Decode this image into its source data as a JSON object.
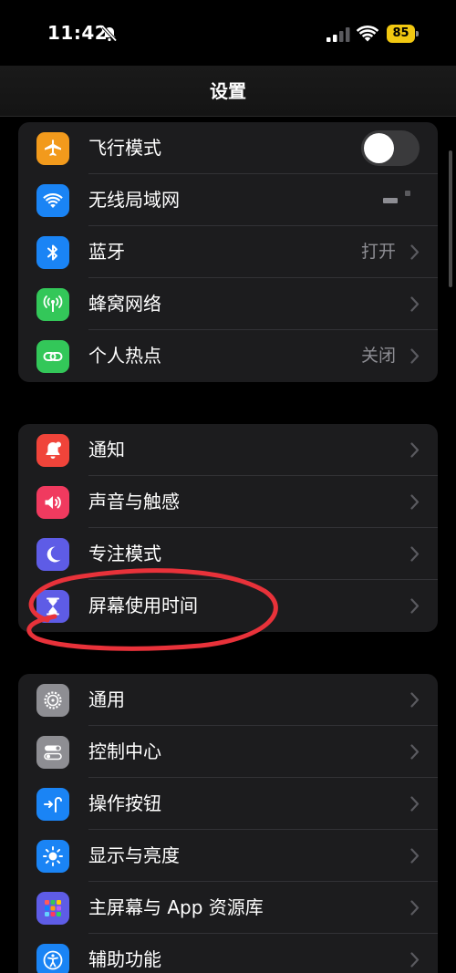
{
  "status_bar": {
    "time": "11:42",
    "battery_level": "85",
    "battery_color": "#f2c811"
  },
  "navbar": {
    "title": "设置"
  },
  "groups": [
    {
      "rows": [
        {
          "label": "飞行模式",
          "icon": "airplane-icon",
          "icon_color": "#f29a1c",
          "control": "toggle",
          "toggle_on": false
        },
        {
          "label": "无线局域网",
          "icon": "wifi-icon",
          "icon_color": "#1a84f5",
          "value": ""
        },
        {
          "label": "蓝牙",
          "icon": "bluetooth-icon",
          "icon_color": "#1a84f5",
          "value": "打开"
        },
        {
          "label": "蜂窝网络",
          "icon": "cellular-icon",
          "icon_color": "#33c759",
          "value": ""
        },
        {
          "label": "个人热点",
          "icon": "hotspot-icon",
          "icon_color": "#33c759",
          "value": "关闭"
        }
      ]
    },
    {
      "rows": [
        {
          "label": "通知",
          "icon": "notification-bell-icon",
          "icon_color": "#f0443a"
        },
        {
          "label": "声音与触感",
          "icon": "speaker-icon",
          "icon_color": "#f03a5f"
        },
        {
          "label": "专注模式",
          "icon": "moon-icon",
          "icon_color": "#5e5ce6"
        },
        {
          "label": "屏幕使用时间",
          "icon": "hourglass-icon",
          "icon_color": "#5e5ce6"
        }
      ]
    },
    {
      "rows": [
        {
          "label": "通用",
          "icon": "gear-icon",
          "icon_color": "#8e8e93"
        },
        {
          "label": "控制中心",
          "icon": "switches-icon",
          "icon_color": "#8e8e93"
        },
        {
          "label": "操作按钮",
          "icon": "action-button-icon",
          "icon_color": "#1a84f5"
        },
        {
          "label": "显示与亮度",
          "icon": "sun-icon",
          "icon_color": "#1a84f5"
        },
        {
          "label": "主屏幕与 App 资源库",
          "icon": "app-grid-icon",
          "icon_color": "#5e5ce6"
        },
        {
          "label": "辅助功能",
          "icon": "accessibility-icon",
          "icon_color": "#1a84f5"
        }
      ]
    }
  ],
  "annotation": {
    "color": "#e8323a"
  }
}
